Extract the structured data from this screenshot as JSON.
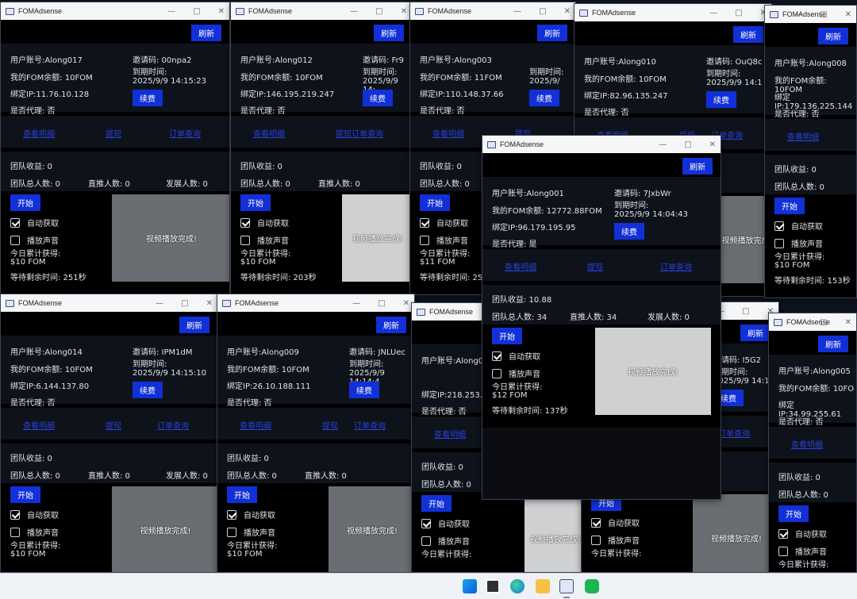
{
  "app_title": "FOMAdsense",
  "labels": {
    "refresh": "刷新",
    "renew": "续费",
    "account_prefix": "用户账号:",
    "balance_prefix": "我的FOM余额: ",
    "ip_prefix": "绑定IP:",
    "proxy_prefix": "是否代理: ",
    "invite_prefix": "邀请码: ",
    "expire_label": "到期时间:",
    "link_view": "查看明细",
    "link_withdraw": "提现",
    "link_orders": "订单查询",
    "team_income_prefix": "团队收益: ",
    "team_total_prefix": "团队总人数: ",
    "direct_prefix": "直推人数: ",
    "develop_prefix": "发展人数: ",
    "start": "开始",
    "auto_fetch": "自动获取",
    "play_sound": "播放声音",
    "today_total": "今日累计获得:",
    "wait_prefix": "等待剩余时间: ",
    "video_done": "视频播放完成!"
  },
  "windows": [
    {
      "account": "Along017",
      "balance": "10FOM",
      "ip": "11.76.10.128",
      "proxy": "否",
      "invite": "00npa2",
      "expire": "2025/9/9 14:15:23",
      "team_income": "0",
      "team_total": "0",
      "direct": "0",
      "develop": "0",
      "today": "$10 FOM",
      "wait": "251秒"
    },
    {
      "account": "Along012",
      "balance": "10FOM",
      "ip": "146.195.219.247",
      "proxy": "否",
      "invite": "Fr9",
      "expire": "2025/9/9 14:",
      "team_income": "0",
      "team_total": "0",
      "direct": "0",
      "develop": "",
      "today": "$10 FOM",
      "wait": "203秒"
    },
    {
      "account": "Along003",
      "balance": "11FOM",
      "ip": "110.148.37.66",
      "proxy": "否",
      "invite": "",
      "expire": "2025/9/",
      "team_income": "0",
      "team_total": "0",
      "direct": "",
      "develop": "",
      "today": "$11 FOM",
      "wait": "25"
    },
    {
      "account": "Along010",
      "balance": "10FOM",
      "ip": "82.96.135.247",
      "proxy": "否",
      "invite": "OuQ8c",
      "expire": "2025/9/9 14:1",
      "team_income": "",
      "team_total": "",
      "direct": "",
      "develop": "",
      "today": "",
      "wait": ""
    },
    {
      "account": "Along008",
      "balance": "10FOM",
      "ip": "179.136.225.144",
      "proxy": "否",
      "invite": "",
      "expire": "",
      "team_income": "0",
      "team_total": "0",
      "direct": "",
      "develop": "",
      "today": "$10 FOM",
      "wait": "153秒"
    },
    {
      "account": "Along014",
      "balance": "10FOM",
      "ip": "6.144.137.80",
      "proxy": "否",
      "invite": "IPM1dM",
      "expire": "2025/9/9 14:15:10",
      "team_income": "0",
      "team_total": "0",
      "direct": "0",
      "develop": "0",
      "today": "$10 FOM",
      "wait": ""
    },
    {
      "account": "Along009",
      "balance": "10FOM",
      "ip": "26.10.188.111",
      "proxy": "否",
      "invite": "JNLUec",
      "expire": "2025/9/9 14:14:4",
      "team_income": "0",
      "team_total": "0",
      "direct": "0",
      "develop": "",
      "today": "$10 FOM",
      "wait": ""
    },
    {
      "account": "Along0",
      "balance": "",
      "ip": "218.253.3",
      "proxy": "否",
      "invite": "",
      "expire": "",
      "team_income": "0",
      "team_total": "0",
      "direct": "",
      "develop": "",
      "today": "",
      "wait": ""
    },
    {
      "account": "",
      "balance": "",
      "ip": "",
      "proxy": "",
      "invite": "I5G2",
      "expire": "2025/9/9 14:1",
      "team_income": "",
      "team_total": "",
      "direct": "",
      "develop": "",
      "today": "",
      "wait": ""
    },
    {
      "account": "Along005",
      "balance": "10FO",
      "ip": "34.99.255.61",
      "proxy": "否",
      "invite": "",
      "expire": "",
      "team_income": "0",
      "team_total": "0",
      "direct": "",
      "develop": "",
      "today": "",
      "wait": ""
    },
    {
      "account": "Along001",
      "balance": "12772.88FOM",
      "ip": "96.179.195.95",
      "proxy": "是",
      "invite": "7JxbWr",
      "expire": "2025/9/9 14:04:43",
      "team_income": "10.88",
      "team_total": "34",
      "direct": "34",
      "develop": "0",
      "today": "$12 FOM",
      "wait": "137秒"
    }
  ]
}
